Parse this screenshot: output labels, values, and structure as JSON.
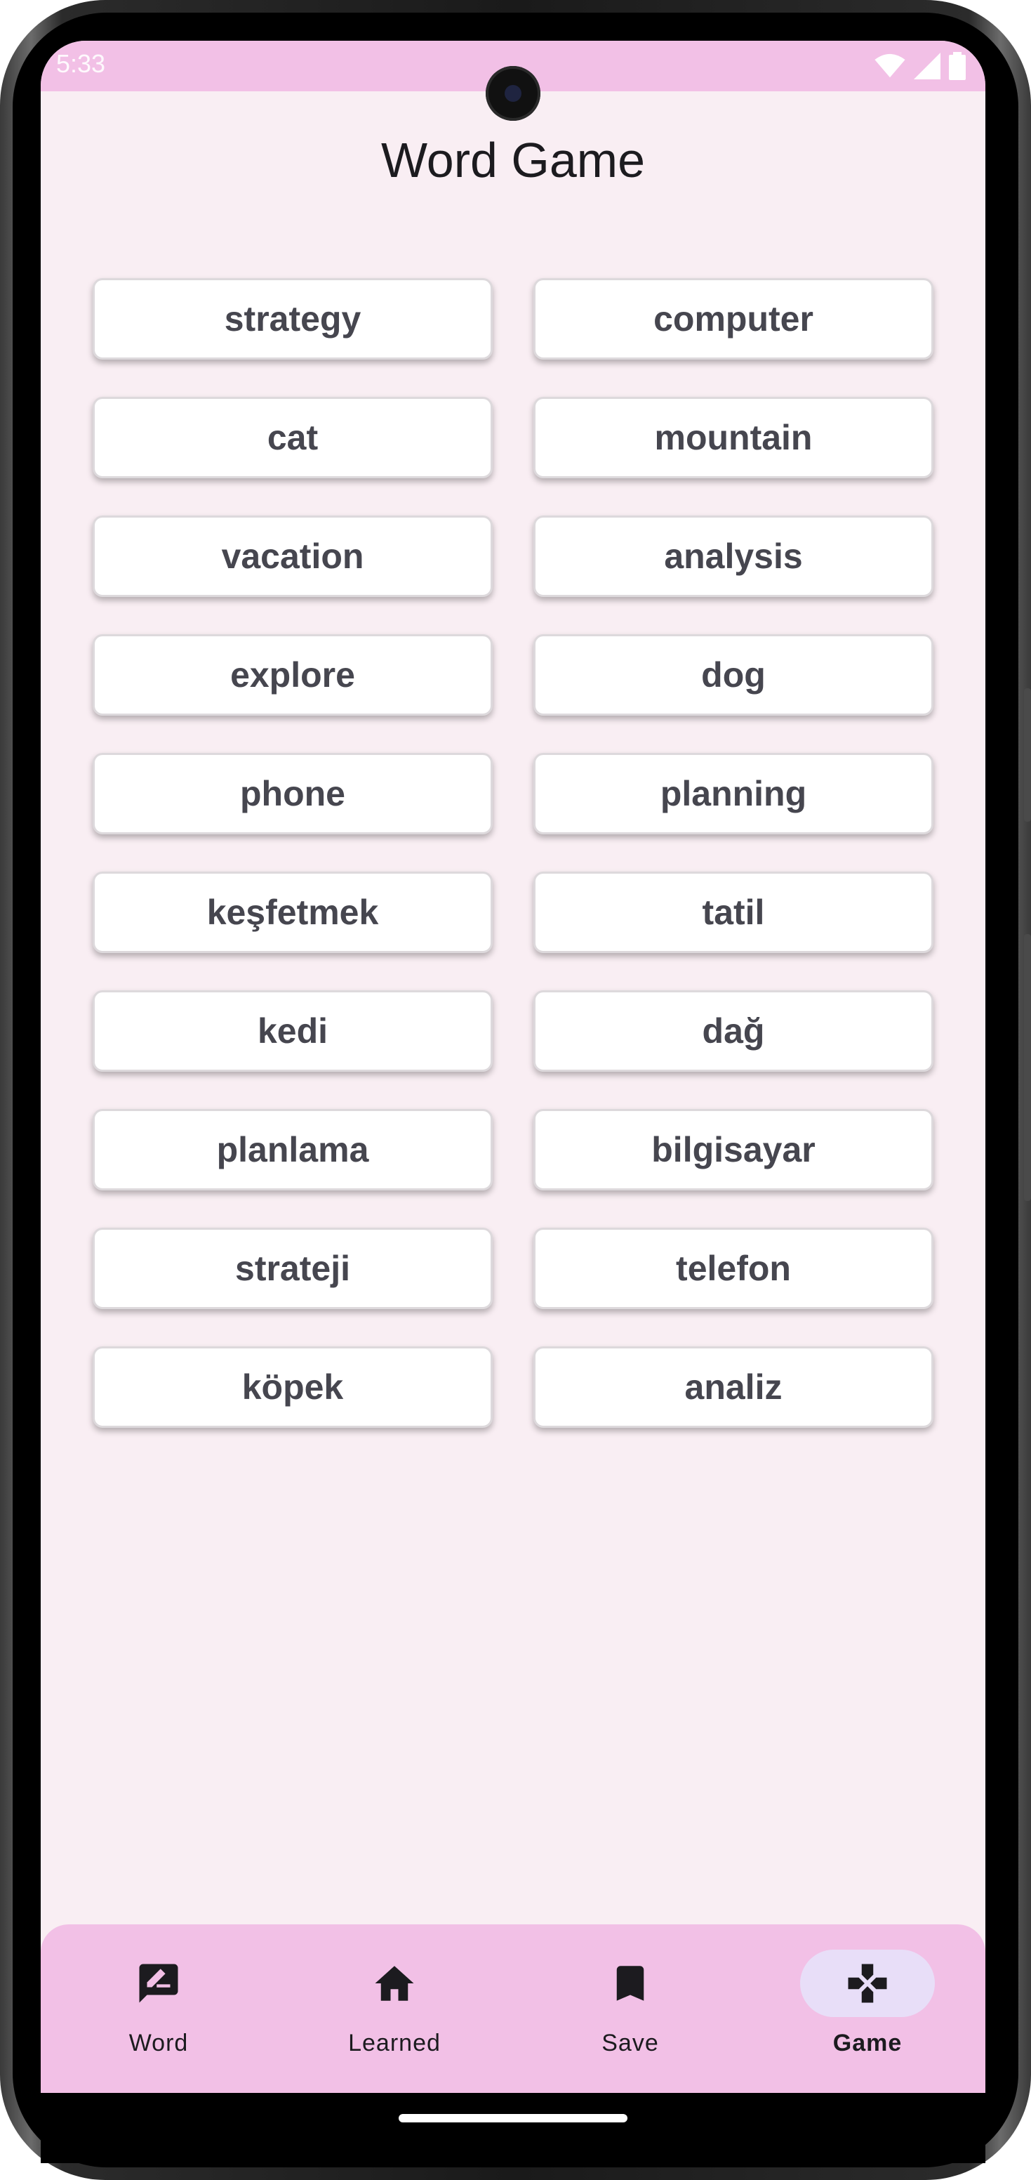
{
  "status_bar": {
    "time": "5:33"
  },
  "app": {
    "title": "Word Game"
  },
  "words": [
    "strategy",
    "computer",
    "cat",
    "mountain",
    "vacation",
    "analysis",
    "explore",
    "dog",
    "phone",
    "planning",
    "keşfetmek",
    "tatil",
    "kedi",
    "dağ",
    "planlama",
    "bilgisayar",
    "strateji",
    "telefon",
    "köpek",
    "analiz"
  ],
  "bottom_nav": {
    "items": [
      {
        "label": "Word",
        "icon": "rate-review-icon",
        "active": false
      },
      {
        "label": "Learned",
        "icon": "home-icon",
        "active": false
      },
      {
        "label": "Save",
        "icon": "bookmark-icon",
        "active": false
      },
      {
        "label": "Game",
        "icon": "gamepad-icon",
        "active": true
      }
    ]
  },
  "colors": {
    "screen_background": "#f9eef3",
    "status_bar": "#f2c0e6",
    "bottom_nav": "#f2c0e6",
    "active_indicator": "#e8def8",
    "card_text": "#46464f"
  }
}
